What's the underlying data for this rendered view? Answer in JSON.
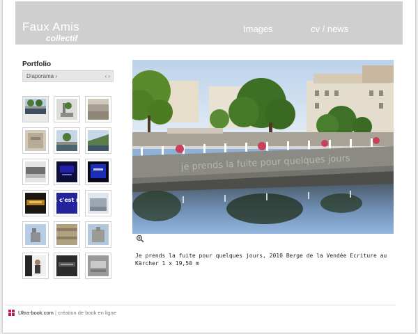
{
  "header": {
    "title": "Faux Amis",
    "subtitle": "collectif",
    "nav": [
      "Images",
      "cv / news"
    ]
  },
  "sidebar": {
    "title": "Portfolio",
    "dropdown_value": "Diaporama ›",
    "dropdown_arrows": "‹ ›"
  },
  "thumb_grid": {
    "thumb_texts": [
      "ici, c'est ma",
      "ici, c'est"
    ]
  },
  "main": {
    "image_overlay_text": "je prends la fuite pour quelques jours",
    "caption": "Je prends la fuite pour quelques jours, 2010 Berge de la Vendée Ecriture au Kärcher 1 x 19,50 m"
  },
  "footer": {
    "brand": "Ultra-book.com",
    "separator": "|",
    "tagline": "création de book en ligne"
  },
  "colors": {
    "header_bg": "#cfcfcf",
    "page_bg": "#ffffff",
    "logo_accent": "#c2185b"
  }
}
